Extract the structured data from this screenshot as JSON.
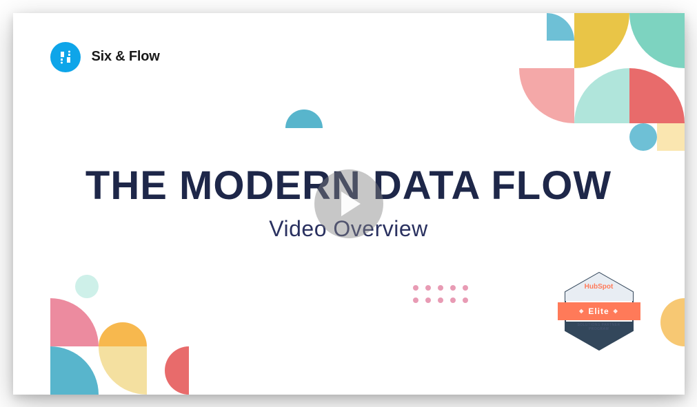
{
  "logo": {
    "text": "Six & Flow"
  },
  "title": "THE MODERN DATA FLOW",
  "subtitle": "Video Overview",
  "badge": {
    "brand": "HubSpot",
    "tier": "Elite",
    "program_line1": "SOLUTIONS PARTNER",
    "program_line2": "PROGRAM"
  },
  "colors": {
    "navy": "#1e2749",
    "teal": "#7dd3c0",
    "yellow": "#e9c547",
    "coral": "#e86b6b",
    "blue": "#0ea5e9",
    "orange": "#ff7a59"
  }
}
